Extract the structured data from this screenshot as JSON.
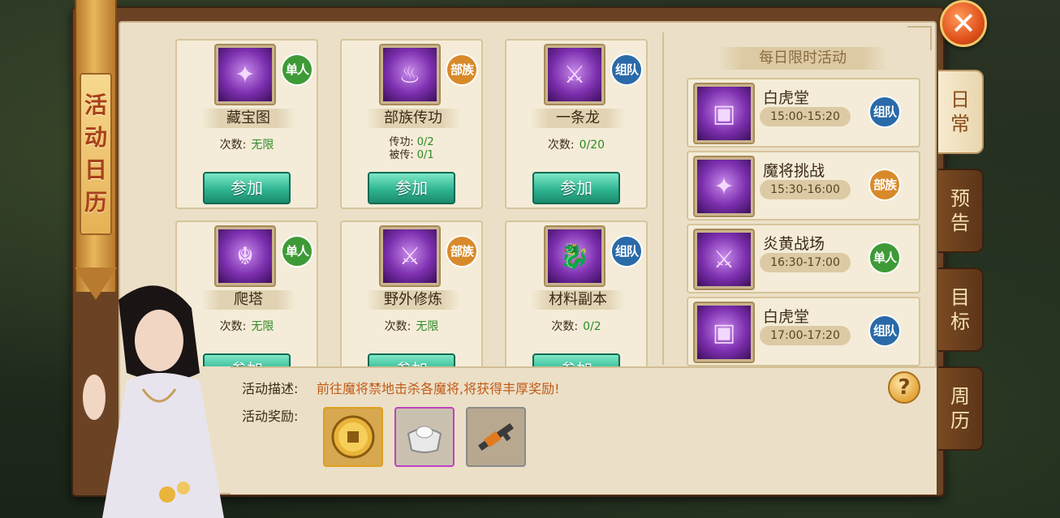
{
  "panel": {
    "title_chars": [
      "活",
      "动",
      "日",
      "历"
    ],
    "close_symbol": "✕"
  },
  "tabs": [
    {
      "label_chars": [
        "日",
        "常"
      ],
      "active": true
    },
    {
      "label_chars": [
        "预",
        "告"
      ],
      "active": false
    },
    {
      "label_chars": [
        "目",
        "标"
      ],
      "active": false
    },
    {
      "label_chars": [
        "周",
        "历"
      ],
      "active": false
    }
  ],
  "activities": [
    {
      "name": "藏宝图",
      "badge": [
        "单",
        "人"
      ],
      "badge_type": "solo",
      "count_label": "次数:",
      "count_value": "无限",
      "button": "参加",
      "icon": "treasure-map-icon"
    },
    {
      "name": "部族传功",
      "badge": [
        "部",
        "族"
      ],
      "badge_type": "tribe",
      "lines": [
        {
          "label": "传功:",
          "value": "0/2"
        },
        {
          "label": "被传:",
          "value": "0/1"
        }
      ],
      "button": "参加",
      "icon": "flame-icon"
    },
    {
      "name": "一条龙",
      "badge": [
        "组",
        "队"
      ],
      "badge_type": "team",
      "count_label": "次数:",
      "count_value": "0/20",
      "button": "参加",
      "icon": "crossed-swords-icon"
    },
    {
      "name": "爬塔",
      "badge": [
        "单",
        "人"
      ],
      "badge_type": "solo",
      "count_label": "次数:",
      "count_value": "无限",
      "button": "参加",
      "icon": "beast-mask-icon"
    },
    {
      "name": "野外修炼",
      "badge": [
        "部",
        "族"
      ],
      "badge_type": "tribe",
      "count_label": "次数:",
      "count_value": "无限",
      "button": "参加",
      "icon": "crossed-swords-icon"
    },
    {
      "name": "材料副本",
      "badge": [
        "组",
        "队"
      ],
      "badge_type": "team",
      "count_label": "次数:",
      "count_value": "0/2",
      "button": "参加",
      "icon": "dragon-emblem-icon"
    }
  ],
  "daily": {
    "header": "每日限时活动",
    "items": [
      {
        "name": "白虎堂",
        "time": "15:00-15:20",
        "badge": [
          "组",
          "队"
        ],
        "badge_type": "team",
        "icon": "treasure-chest-icon"
      },
      {
        "name": "魔将挑战",
        "time": "15:30-16:00",
        "badge": [
          "部",
          "族"
        ],
        "badge_type": "tribe",
        "icon": "treasure-map-icon"
      },
      {
        "name": "炎黄战场",
        "time": "16:30-17:00",
        "badge": [
          "单",
          "人"
        ],
        "badge_type": "solo",
        "icon": "crossed-swords-icon"
      },
      {
        "name": "白虎堂",
        "time": "17:00-17:20",
        "badge": [
          "组",
          "队"
        ],
        "badge_type": "team",
        "icon": "treasure-chest-icon"
      }
    ]
  },
  "description": {
    "label": "活动描述:",
    "text": "前往魔将禁地击杀各魔将,将获得丰厚奖励!",
    "reward_label": "活动奖励:",
    "help_symbol": "?"
  },
  "rewards": [
    {
      "icon": "gold-coin-icon",
      "border": "#e0a020"
    },
    {
      "icon": "silver-ingot-icon",
      "border": "#c040c0"
    },
    {
      "icon": "rifle-icon",
      "border": "#8a8a8a"
    }
  ],
  "colors": {
    "green_value": "#2f8a28",
    "desc_orange": "#c25a18",
    "button_teal": "#2fb592"
  }
}
